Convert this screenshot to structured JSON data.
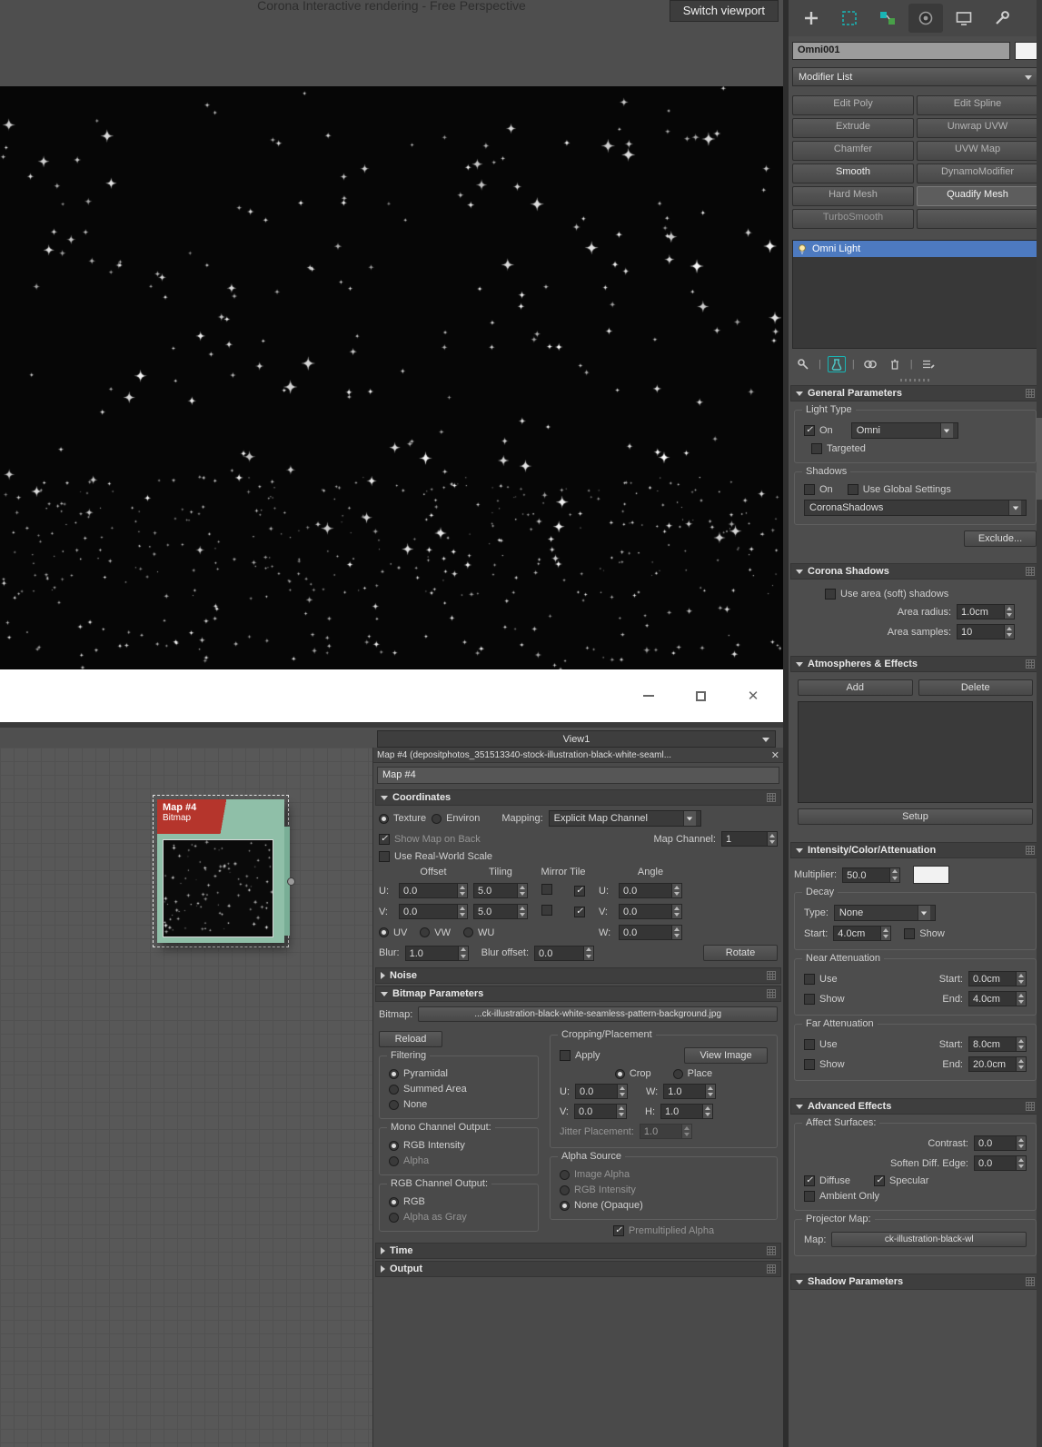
{
  "colors": {
    "selection_blue": "#4d7ac0",
    "accent_teal": "#19b5b5",
    "node_red": "#b5352c",
    "node_green": "#8fbfa8"
  },
  "viewport": {
    "title": "Corona Interactive rendering - Free Perspective",
    "switch_button": "Switch viewport"
  },
  "view_bar": {
    "selected_view": "View1"
  },
  "node_editor": {
    "node_title": "Map #4",
    "node_type": "Bitmap"
  },
  "map_panel": {
    "header": "Map #4 (depositphotos_351513340-stock-illustration-black-white-seaml...",
    "name": "Map #4",
    "coordinates": {
      "title": "Coordinates",
      "texture": "Texture",
      "environ": "Environ",
      "mapping_label": "Mapping:",
      "mapping_value": "Explicit Map Channel",
      "show_map_on_back": "Show Map on Back",
      "map_channel_label": "Map Channel:",
      "map_channel_value": "1",
      "use_real_world_scale": "Use Real-World Scale",
      "offset": "Offset",
      "tiling": "Tiling",
      "mirror_tile": "Mirror Tile",
      "angle": "Angle",
      "u_label": "U:",
      "v_label": "V:",
      "w_label": "W:",
      "u_offset": "0.0",
      "u_tiling": "5.0",
      "u_angle": "0.0",
      "v_offset": "0.0",
      "v_tiling": "5.0",
      "v_angle": "0.0",
      "w_angle": "0.0",
      "uv": "UV",
      "vw": "VW",
      "wu": "WU",
      "blur_label": "Blur:",
      "blur_value": "1.0",
      "blur_offset_label": "Blur offset:",
      "blur_offset_value": "0.0",
      "rotate": "Rotate"
    },
    "noise_title": "Noise",
    "bitmap_params": {
      "title": "Bitmap Parameters",
      "bitmap_label": "Bitmap:",
      "bitmap_path": "...ck-illustration-black-white-seamless-pattern-background.jpg",
      "reload": "Reload",
      "cropping_title": "Cropping/Placement",
      "apply": "Apply",
      "view_image": "View Image",
      "crop": "Crop",
      "place": "Place",
      "u_label": "U:",
      "u_value": "0.0",
      "v_label": "V:",
      "v_value": "0.0",
      "w_label": "W:",
      "w_value": "1.0",
      "h_label": "H:",
      "h_value": "1.0",
      "jitter_label": "Jitter Placement:",
      "jitter_value": "1.0",
      "filtering_title": "Filtering",
      "pyramidal": "Pyramidal",
      "summed_area": "Summed Area",
      "none": "None",
      "mono_title": "Mono Channel Output:",
      "rgb_intensity": "RGB Intensity",
      "alpha": "Alpha",
      "rgb_title": "RGB Channel Output:",
      "rgb": "RGB",
      "alpha_as_gray": "Alpha as Gray",
      "alpha_source_title": "Alpha Source",
      "image_alpha": "Image Alpha",
      "rgb_intensity2": "RGB Intensity",
      "none_opaque": "None (Opaque)",
      "premultiplied_alpha": "Premultiplied Alpha"
    },
    "time_title": "Time",
    "output_title": "Output"
  },
  "command_panel": {
    "object_name": "Omni001",
    "modifier_list": "Modifier List",
    "modifier_buttons": [
      "Edit Poly",
      "Edit Spline",
      "Extrude",
      "Unwrap UVW",
      "Chamfer",
      "UVW Map",
      "Smooth",
      "DynamoModifier",
      "Hard Mesh",
      "Quadify Mesh",
      "TurboSmooth",
      ""
    ],
    "stack_item": "Omni Light",
    "general_params": {
      "title": "General Parameters",
      "light_type": "Light Type",
      "on": "On",
      "type_value": "Omni",
      "targeted": "Targeted",
      "shadows": "Shadows",
      "shadows_on": "On",
      "use_global": "Use Global Settings",
      "shadow_plugin": "CoronaShadows",
      "exclude": "Exclude..."
    },
    "corona_shadows": {
      "title": "Corona Shadows",
      "use_area": "Use area (soft) shadows",
      "area_radius_label": "Area radius:",
      "area_radius": "1.0cm",
      "area_samples_label": "Area samples:",
      "area_samples": "10"
    },
    "atmospheres": {
      "title": "Atmospheres & Effects",
      "add": "Add",
      "delete": "Delete",
      "setup": "Setup"
    },
    "intensity": {
      "title": "Intensity/Color/Attenuation",
      "multiplier_label": "Multiplier:",
      "multiplier": "50.0",
      "decay": "Decay",
      "type_label": "Type:",
      "decay_type": "None",
      "start_label": "Start:",
      "decay_start": "4.0cm",
      "show": "Show",
      "near": "Near Attenuation",
      "use": "Use",
      "near_start": "0.0cm",
      "end_label": "End:",
      "near_end": "4.0cm",
      "far": "Far Attenuation",
      "far_start": "8.0cm",
      "far_end": "20.0cm"
    },
    "advanced": {
      "title": "Advanced Effects",
      "affect_surfaces": "Affect Surfaces:",
      "contrast_label": "Contrast:",
      "contrast": "0.0",
      "soften_label": "Soften Diff. Edge:",
      "soften": "0.0",
      "diffuse": "Diffuse",
      "specular": "Specular",
      "ambient_only": "Ambient Only",
      "projector_map": "Projector Map:",
      "map_label": "Map:",
      "map_value": "ck-illustration-black-wl"
    },
    "shadow_params": {
      "title": "Shadow Parameters"
    }
  }
}
